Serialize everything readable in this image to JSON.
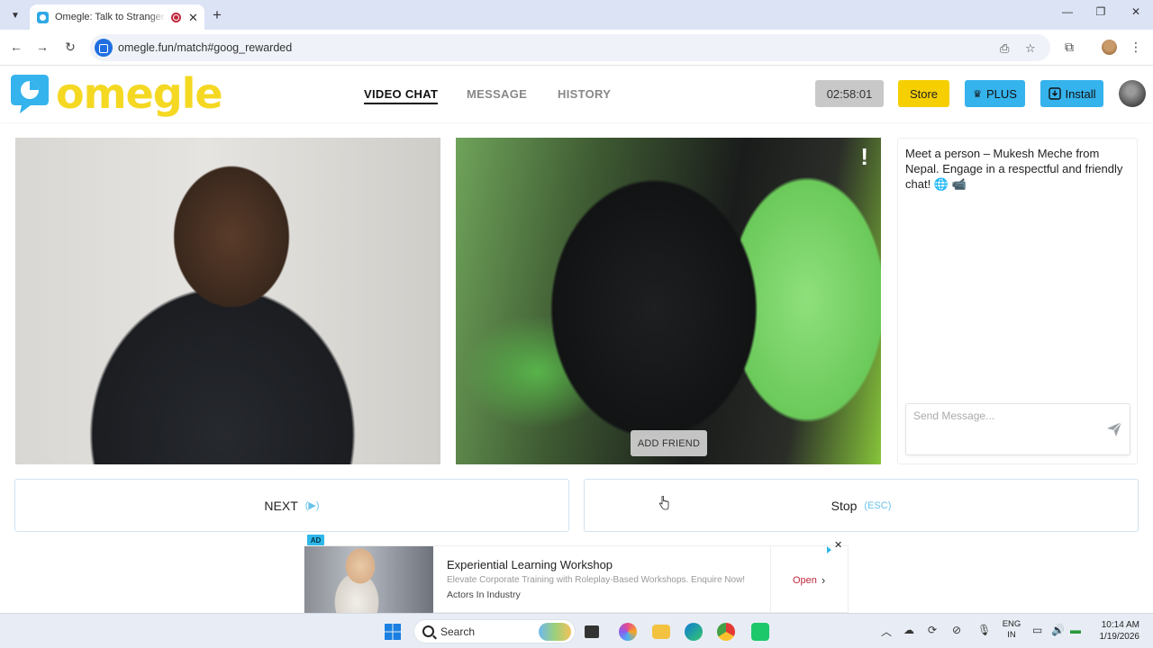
{
  "browser": {
    "tab_title": "Omegle: Talk to Strangers with",
    "url": "omegle.fun/match#goog_rewarded"
  },
  "header": {
    "logo_text": "omegle",
    "nav": [
      {
        "label": "VIDEO CHAT",
        "active": true
      },
      {
        "label": "MESSAGE",
        "active": false
      },
      {
        "label": "HISTORY",
        "active": false
      }
    ],
    "timer": "02:58:01",
    "store_label": "Store",
    "plus_label": "PLUS",
    "install_label": "Install"
  },
  "video": {
    "report_label": "!",
    "add_friend_label": "ADD FRIEND"
  },
  "chat": {
    "intro": "Meet a person – Mukesh Meche from Nepal. Engage in a respectful and friendly chat! 🌐 📹",
    "placeholder": "Send Message..."
  },
  "actions": {
    "next_label": "NEXT",
    "next_shortcut": "(▶)",
    "stop_label": "Stop",
    "stop_shortcut": "(ESC)"
  },
  "ad": {
    "badge": "AD",
    "title": "Experiential Learning Workshop",
    "description": "Elevate Corporate Training with Roleplay-Based Workshops. Enquire Now!",
    "advertiser": "Actors In Industry",
    "cta": "Open"
  },
  "taskbar": {
    "search_label": "Search",
    "lang_line1": "ENG",
    "lang_line2": "IN",
    "time": "10:14 AM",
    "date": "1/19/2026"
  },
  "colors": {
    "brand_yellow": "#f4d822",
    "brand_blue": "#35b3ec",
    "store_yellow": "#f6cf00"
  }
}
